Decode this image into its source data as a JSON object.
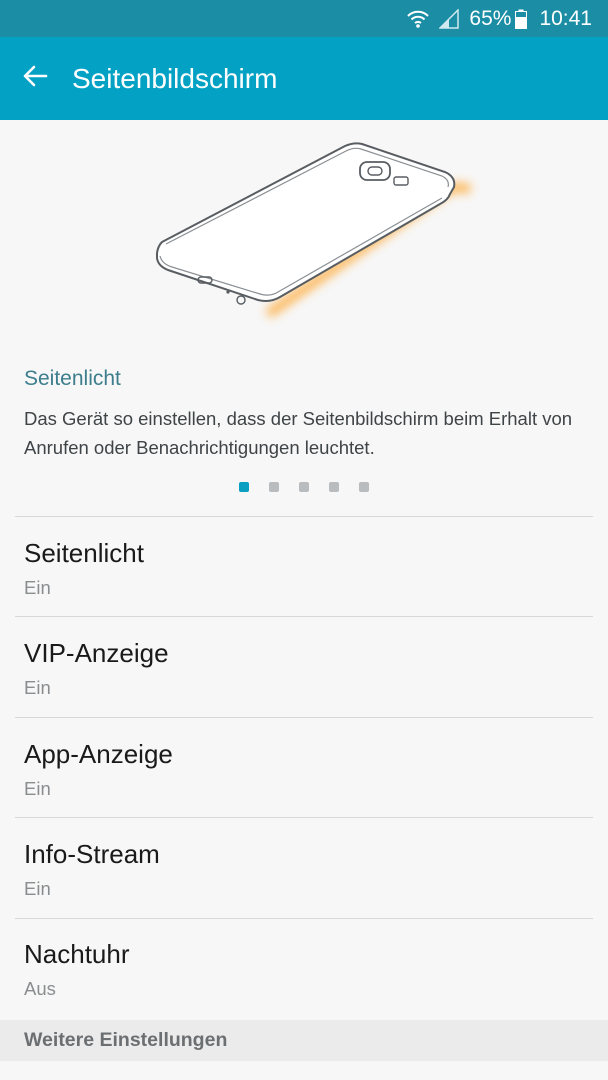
{
  "status_bar": {
    "battery": "65%",
    "time": "10:41",
    "icons": [
      "wifi-icon",
      "signal-icon",
      "battery-icon"
    ]
  },
  "app_bar": {
    "title": "Seitenbildschirm",
    "back_icon": "arrow-left-icon",
    "color": "#03a2c4"
  },
  "feature": {
    "title": "Seitenlicht",
    "description": "Das Gerät so einstellen, dass der Seitenbildschirm beim Erhalt von Anrufen oder Benachrichtigungen leuchtet.",
    "page_count": 5,
    "current_page": 1,
    "illustration": "phone-edge-lighting-illustration",
    "glow_color": "#ffb347"
  },
  "settings": [
    {
      "title": "Seitenlicht",
      "value": "Ein"
    },
    {
      "title": "VIP-Anzeige",
      "value": "Ein"
    },
    {
      "title": "App-Anzeige",
      "value": "Ein"
    },
    {
      "title": "Info-Stream",
      "value": "Ein"
    },
    {
      "title": "Nachtuhr",
      "value": "Aus"
    }
  ],
  "section": {
    "header": "Weitere Einstellungen"
  }
}
